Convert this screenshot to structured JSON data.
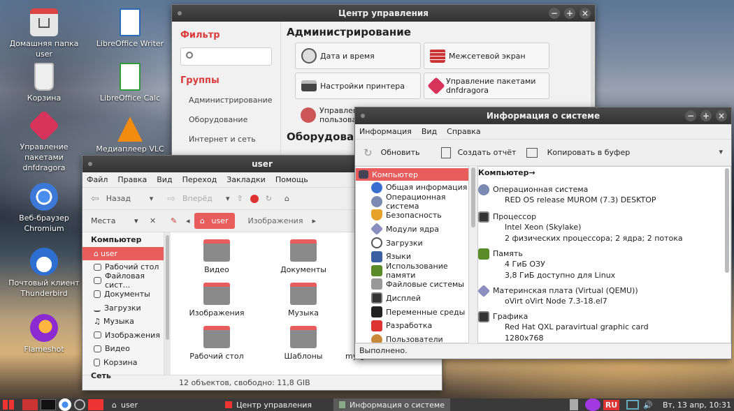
{
  "desktop": {
    "icons": [
      {
        "label": "Домашняя папка user",
        "icon": "home-folder-icon"
      },
      {
        "label": "Корзина",
        "icon": "trash-icon"
      },
      {
        "label": "Управление пакетами dnfdragora",
        "icon": "package-icon"
      },
      {
        "label": "Веб-браузер Chromium",
        "icon": "chromium-icon"
      },
      {
        "label": "Почтовый клиент Thunderbird",
        "icon": "thunderbird-icon"
      },
      {
        "label": "Flameshot",
        "icon": "flameshot-icon"
      },
      {
        "label": "LibreOffice Writer",
        "icon": "writer-icon"
      },
      {
        "label": "LibreOffice Calc",
        "icon": "calc-icon"
      },
      {
        "label": "Медиаплеер VLC",
        "icon": "vlc-icon"
      }
    ]
  },
  "control_center": {
    "title": "Центр управления",
    "filter_label": "Фильтр",
    "search_placeholder": "",
    "groups_label": "Группы",
    "groups": [
      "Администрирование",
      "Оборудование",
      "Интернет и сеть"
    ],
    "section_admin": "Администрирование",
    "section_hw": "Оборудование",
    "items": [
      {
        "label": "Дата и время",
        "icon": "clock-icon"
      },
      {
        "label": "Межсетевой экран",
        "icon": "firewall-icon"
      },
      {
        "label": "Настройки принтера",
        "icon": "printer-icon"
      },
      {
        "label": "Управление пакетами dnfdragora",
        "icon": "package-icon"
      },
      {
        "label": "Управление пользова",
        "icon": "users-icon"
      }
    ]
  },
  "file_manager": {
    "title": "user",
    "menu": [
      "Файл",
      "Правка",
      "Вид",
      "Переход",
      "Закладки",
      "Помощь"
    ],
    "back": "Назад",
    "forward": "Вперёд",
    "places_label": "Места",
    "path_current": "user",
    "path_next": "Изображения",
    "sidebar_section": "Компьютер",
    "sidebar": [
      "user",
      "Рабочий стол",
      "Файловая сист...",
      "Документы",
      "Загрузки",
      "Музыка",
      "Изображения",
      "Видео",
      "Корзина"
    ],
    "sidebar_section2": "Сеть",
    "files": [
      "Видео",
      "Документы",
      "Изображения",
      "Музыка",
      "Рабочий стол",
      "Шаблоны",
      "my-gdmsessionwor..."
    ],
    "status": "12 объектов, свободно: 11,8 GIB"
  },
  "sysinfo": {
    "title": "Информация о системе",
    "menu": [
      "Информация",
      "Вид",
      "Справка"
    ],
    "btn_refresh": "Обновить",
    "btn_report": "Создать отчёт",
    "btn_copy": "Копировать в буфер",
    "tree": [
      "Компьютер",
      "Общая информация",
      "Операционная система",
      "Безопасность",
      "Модули ядра",
      "Загрузки",
      "Языки",
      "Использование памяти",
      "Файловые системы",
      "Дисплей",
      "Переменные среды",
      "Разработка",
      "Пользователи"
    ],
    "heading": "Компьютер→",
    "details": [
      {
        "title": "Операционная система",
        "lines": [
          "RED OS release MUROM (7.3) DESKTOP"
        ]
      },
      {
        "title": "Процессор",
        "lines": [
          "Intel Xeon (Skylake)",
          "2 физических процессора; 2 ядра; 2 потока"
        ]
      },
      {
        "title": "Память",
        "lines": [
          "4 ГиБ ОЗУ",
          "3,8 ГиБ доступно для Linux"
        ]
      },
      {
        "title": "Материнская плата (Virtual (QEMU))",
        "lines": [
          "oVirt oVirt Node 7.3-18.el7"
        ]
      },
      {
        "title": "Графика",
        "lines": [
          "Red Hat QXL paravirtual graphic card",
          "1280x768"
        ]
      }
    ],
    "status": "Выполнено."
  },
  "taskbar": {
    "tasks": [
      "user",
      "Центр управления",
      "Информация о системе"
    ],
    "lang": "RU",
    "clock": "Вт, 13 апр, 10:31"
  }
}
